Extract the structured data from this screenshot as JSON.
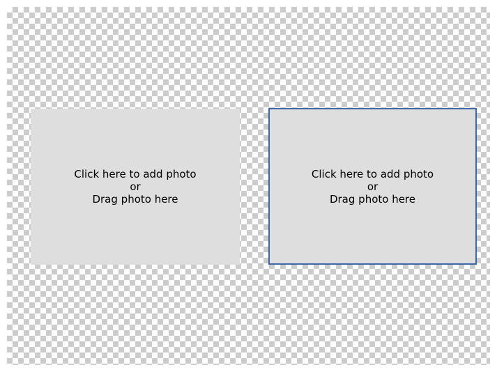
{
  "slots": [
    {
      "line1": "Click here to add photo",
      "line2": "or",
      "line3": "Drag photo here",
      "selected": false
    },
    {
      "line1": "Click here to add photo",
      "line2": "or",
      "line3": "Drag photo here",
      "selected": true
    }
  ],
  "colors": {
    "slot_background": "#dedede",
    "selected_border": "#3f68a6",
    "checker_dark": "#cccccc",
    "checker_light": "#ffffff"
  }
}
